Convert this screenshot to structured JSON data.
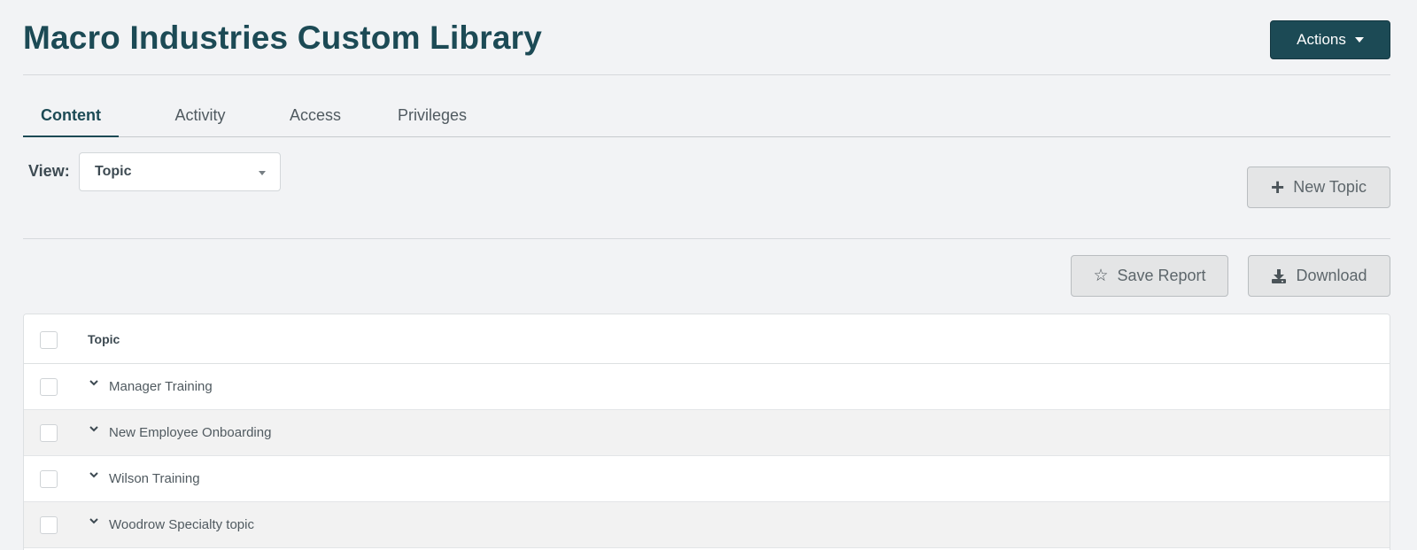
{
  "header": {
    "title": "Macro Industries Custom Library",
    "actions_label": "Actions"
  },
  "tabs": [
    {
      "label": "Content",
      "active": true
    },
    {
      "label": "Activity",
      "active": false
    },
    {
      "label": "Access",
      "active": false
    },
    {
      "label": "Privileges",
      "active": false
    }
  ],
  "view": {
    "label": "View:",
    "selected": "Topic"
  },
  "buttons": {
    "new_topic": "New Topic",
    "save_report": "Save Report",
    "download": "Download"
  },
  "table": {
    "header": "Topic",
    "rows": [
      {
        "label": "Manager Training"
      },
      {
        "label": "New Employee Onboarding"
      },
      {
        "label": "Wilson Training"
      },
      {
        "label": "Woodrow Specialty topic"
      }
    ]
  },
  "icons": {
    "actions_caret": "caret-down-icon",
    "new_topic": "plus-icon",
    "save_report": "star-icon",
    "download": "download-icon",
    "row_toggle": "chevron-down-icon"
  },
  "colors": {
    "brand": "#1c4a55",
    "background": "#f2f3f5",
    "button_grey": "#e4e5e6"
  }
}
